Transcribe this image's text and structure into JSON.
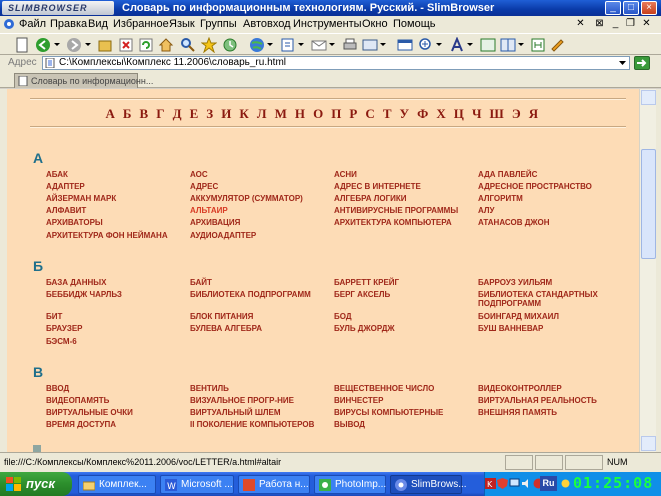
{
  "window": {
    "logo": "SLIMBROWSER",
    "title": "Словарь по информационным технологиям. Русский. - SlimBrowser"
  },
  "menu": {
    "items": [
      "Файл",
      "Правка",
      "Вид",
      "Избранное",
      "Язык",
      "Группы",
      "Автовход",
      "Инструменты",
      "Окно",
      "Помощь"
    ]
  },
  "address": {
    "label": "Адрес",
    "value": "C:\\Комплексы\\Комплекс 11.2006\\словарь_ru.html"
  },
  "tab": {
    "label": "Словарь по информационн..."
  },
  "content": {
    "alphabet": "А Б В Г Д Е З И К Л М Н О П Р С Т У Ф Х Ц Ч Ш Э Я",
    "sections": [
      {
        "letter": "А",
        "terms": [
          "АБАК",
          "АОС",
          "АСНИ",
          "АДА ПАВЛЕЙС",
          "АДАПТЕР",
          "АДРЕС",
          "АДРЕС В ИНТЕРНЕТЕ",
          "АДРЕСНОЕ ПРОСТРАНСТВО",
          "АЙЗЕРМАН МАРК",
          "АККУМУЛЯТОР (СУММАТОР)",
          "АЛГЕБРА ЛОГИКИ",
          "АЛГОРИТМ",
          "АЛФАВИТ",
          "АЛЬТАИР",
          "АНТИВИРУСНЫЕ ПРОГРАММЫ",
          "АЛУ",
          "АРХИВАТОРЫ",
          "АРХИВАЦИЯ",
          "АРХИТЕКТУРА КОМПЬЮТЕРА",
          "АТАНАСОВ ДЖОН",
          "АРХИТЕКТУРА ФОН НЕЙМАНА",
          "АУДИОАДАПТЕР"
        ]
      },
      {
        "letter": "Б",
        "terms": [
          "БАЗА ДАННЫХ",
          "БАЙТ",
          "БАРРЕТТ КРЕЙГ",
          "БАРРОУЗ УИЛЬЯМ",
          "БЕББИДЖ ЧАРЛЬЗ",
          "БИБЛИОТЕКА ПОДПРОГРАММ",
          "БЕРГ АКСЕЛЬ",
          "БИБЛИОТЕКА СТАНДАРТНЫХ ПОДПРОГРАММ",
          "БИТ",
          "БЛОК ПИТАНИЯ",
          "БОД",
          "БОИНГАРД МИХАИЛ",
          "БРАУЗЕР",
          "БУЛЕВА АЛГЕБРА",
          "БУЛЬ ДЖОРДЖ",
          "БУШ ВАННЕВАР",
          "БЭСМ-6"
        ]
      },
      {
        "letter": "В",
        "terms": [
          "ВВОД",
          "ВЕНТИЛЬ",
          "ВЕЩЕСТВЕННОЕ ЧИСЛО",
          "ВИДЕОКОНТРОЛЛЕР",
          "ВИДЕОПАМЯТЬ",
          "ВИЗУАЛЬНОЕ ПРОГР-НИЕ",
          "ВИНЧЕСТЕР",
          "ВИРТУАЛЬНАЯ РЕАЛЬНОСТЬ",
          "ВИРТУАЛЬНЫЕ ОЧКИ",
          "ВИРТУАЛЬНЫЙ ШЛЕМ",
          "ВИРУСЫ КОМПЬЮТЕРНЫЕ",
          "ВНЕШНЯЯ ПАМЯТЬ",
          "ВРЕМЯ ДОСТУПА",
          "II ПОКОЛЕНИЕ КОМПЬЮТЕРОВ",
          "ВЫВОД"
        ]
      }
    ]
  },
  "status": {
    "url": "file:///C:/Комплексы/Комплекс%2011.2006/voc/LETTER/a.html#altair",
    "num": "NUM"
  },
  "taskbar": {
    "start": "пуск",
    "tasks": [
      "Комплек...",
      "Microsoft ...",
      "Работа н...",
      "PhotoImp...",
      "SlimBrows..."
    ],
    "lang": "Ru",
    "clock": "01:25:08"
  },
  "colors": {
    "page_bg": "#fddcb6",
    "term": "#a0281a",
    "term_highlight": "#d83a24",
    "letter_heading": "#1f6f8b",
    "alphabet": "#8b1a10"
  }
}
